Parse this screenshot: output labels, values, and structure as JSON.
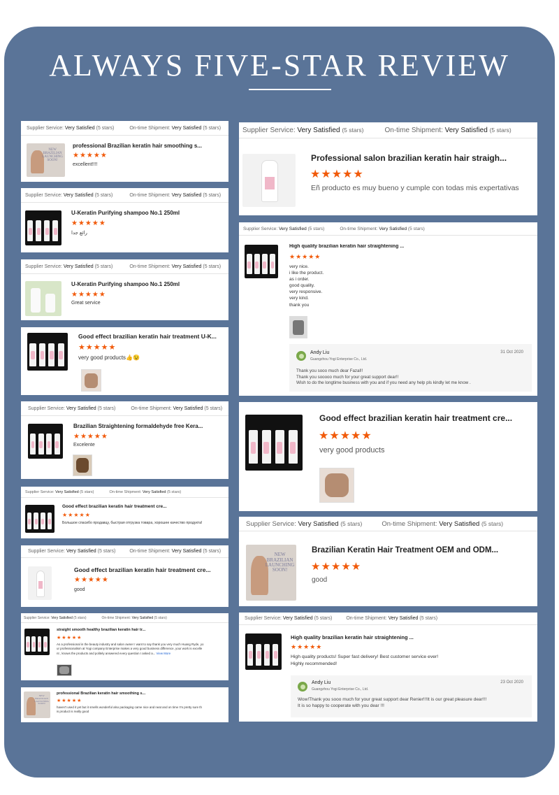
{
  "title": "ALWAYS FIVE-STAR REVIEW",
  "colors": {
    "panel": "#5a7498",
    "star": "#f15a0a"
  },
  "labels": {
    "supplier": "Supplier Service:",
    "shipment": "On-time Shipment:",
    "very_satisfied": "Very Satisfied",
    "five_stars": "(5 stars)",
    "stars_glyph": "★★★★★"
  },
  "left": [
    {
      "product": "professional Brazilian keratin hair smoothing s...",
      "text": "excellent!!!!",
      "rating": 5
    },
    {
      "product": "U-Keratin Purifying shampoo No.1 250ml",
      "text": "رائع جدا",
      "rating": 5
    },
    {
      "product": "U-Keratin Purifying shampoo No.1 250ml",
      "text": "Great service",
      "rating": 5
    },
    {
      "product": "Good effect brazilian keratin hair treatment U-K...",
      "text": "very good products👍😉",
      "rating": 5
    },
    {
      "product": "Brazilian Straightening formaldehyde free Kera...",
      "text": "Excelente",
      "rating": 5
    },
    {
      "product": "Good effect brazilian keratin hair treatment cre...",
      "text": "Большое спасибо продавцу, быстрая отгрузка товара, хорошее качество продукта!",
      "rating": 5
    },
    {
      "product": "Good effect brazilian keratin hair treatment cre...",
      "text": "good",
      "rating": 5
    },
    {
      "product": "straight smooth healthy brazilian keratin hair tr...",
      "text": "As a professional in the beauty industry and salon owner I want to say thank you very much Huang Ryde, yo\nur professionalism at Yogi company Enterprise makes a very good business difference, your work is excelle\nnt , knows the products and politely answered every question I asked a... ",
      "view_more": "View More",
      "rating": 5
    },
    {
      "product": "professional Brazilian keratin hair smoothing s...",
      "text": "haven't used it yet but it smells wonderful also packaging came nice and neat and on time I'm pretty sure th\nis product is really good",
      "rating": 5
    }
  ],
  "right": [
    {
      "product": "Professional salon brazilian keratin hair straigh...",
      "text": "Eñ producto es muy bueno y cumple con todas mis expertativas",
      "rating": 5
    },
    {
      "product": "High quality brazilian keratin hair straightening ...",
      "text": "very nice.\ni like the product.\nas i order.\ngood quality.\nvery responsive.\nvery kind.\nthank you",
      "rating": 5,
      "reply": {
        "name": "Andy Liu",
        "company": "Guangzhou Yogi Enterprise Co., Ltd.",
        "date": "31 Oct 2020",
        "text": "Thank you sooo much dear Fazal!!\nThank you sooooo  much for your great support dear!!\nWish to do the longtime business with you and if you need any help pls kindly let me know ."
      }
    },
    {
      "product": "Good effect brazilian keratin hair treatment cre...",
      "text": "very good products",
      "rating": 5
    },
    {
      "product": "Brazilian Keratin Hair Treatment OEM and ODM...",
      "text": "good",
      "rating": 5
    },
    {
      "product": "High quality brazilian keratin hair straightening ...",
      "text": "High quality products! Super fast delivery! Best customer service ever!\nHighly recommended!",
      "rating": 5,
      "reply": {
        "name": "Andy Liu",
        "company": "Guangzhou Yogi Enterprise Co., Ltd.",
        "date": "23 Oct 2020",
        "text": "Wow!Thank you sooo much for your great support dear Renier!!!It is our great pleasure dear!!!\n It  is so happy to cooperate with you dear !!!"
      }
    }
  ],
  "launch_text": "NEW BRAZILIAN\nLAUNCHING\nSOON!"
}
